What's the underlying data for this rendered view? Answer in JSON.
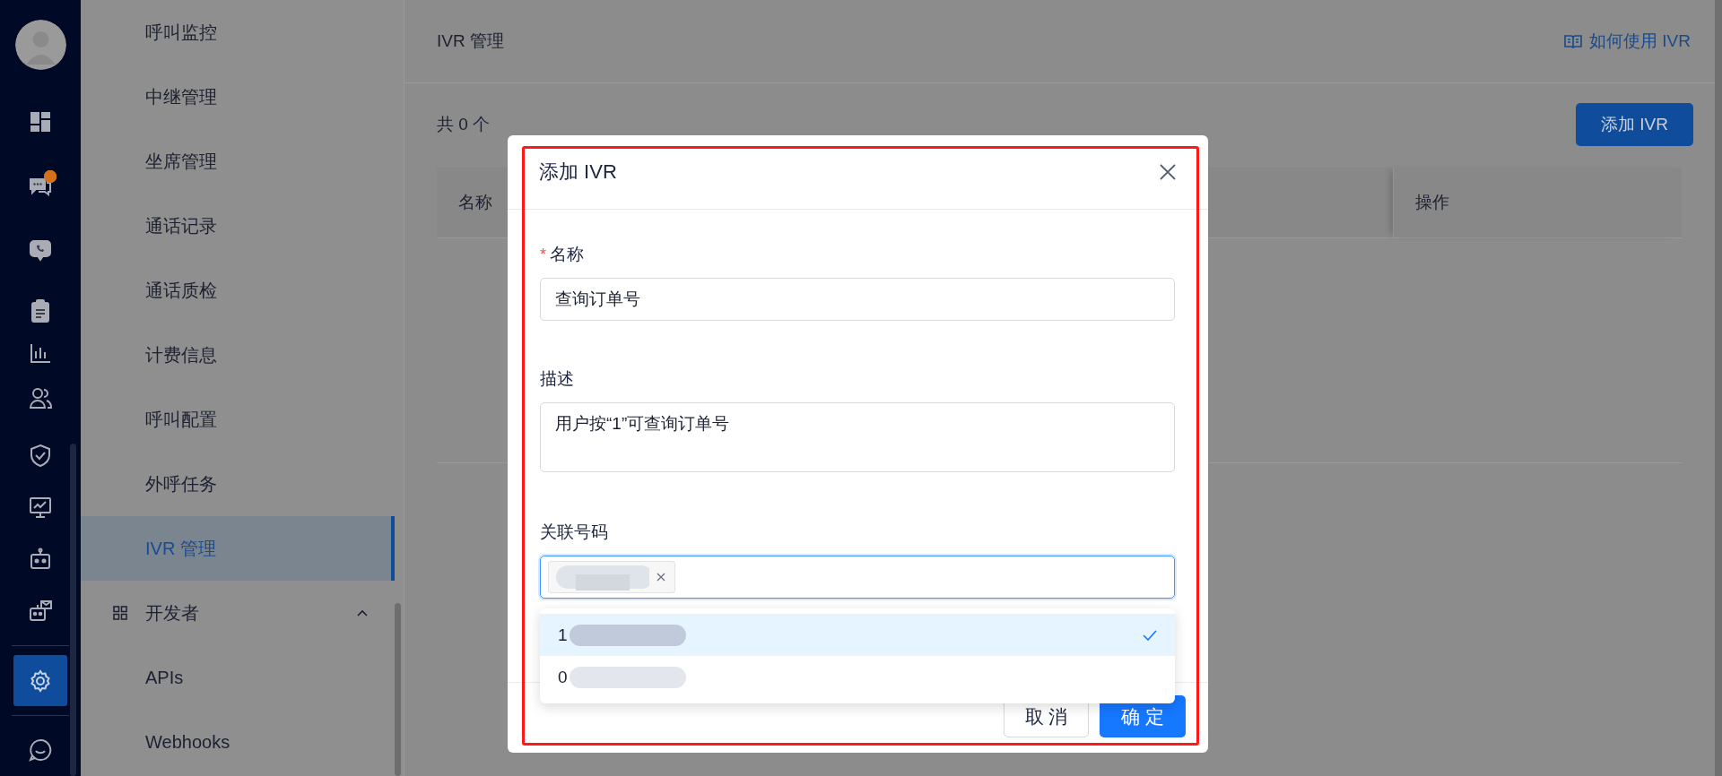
{
  "rail": {
    "items": [
      {
        "selected": false,
        "badge": false
      },
      {
        "selected": false,
        "badge": true
      },
      {
        "selected": false,
        "badge": false
      },
      {
        "selected": false,
        "badge": false
      },
      {
        "selected": false,
        "badge": false
      },
      {
        "selected": false,
        "badge": false
      },
      {
        "selected": false,
        "badge": false
      },
      {
        "selected": false,
        "badge": false
      },
      {
        "selected": false,
        "badge": false
      },
      {
        "selected": false,
        "badge": false
      },
      {
        "selected": true,
        "badge": false
      },
      {
        "selected": false,
        "badge": false
      }
    ]
  },
  "submenu": {
    "items": [
      {
        "kind": "item",
        "label": "呼叫监控",
        "selected": false
      },
      {
        "kind": "item",
        "label": "中继管理",
        "selected": false
      },
      {
        "kind": "item",
        "label": "坐席管理",
        "selected": false
      },
      {
        "kind": "item",
        "label": "通话记录",
        "selected": false
      },
      {
        "kind": "item",
        "label": "通话质检",
        "selected": false
      },
      {
        "kind": "item",
        "label": "计费信息",
        "selected": false
      },
      {
        "kind": "item",
        "label": "呼叫配置",
        "selected": false
      },
      {
        "kind": "item",
        "label": "外呼任务",
        "selected": false
      },
      {
        "kind": "item",
        "label": "IVR 管理",
        "selected": true
      },
      {
        "kind": "group",
        "label": "开发者",
        "expanded": true,
        "children": [
          {
            "label": "APIs",
            "selected": false
          },
          {
            "label": "Webhooks",
            "selected": false
          }
        ]
      }
    ]
  },
  "main": {
    "title": "IVR 管理",
    "help_link": "如何使用 IVR",
    "count": "共 0 个",
    "add_button": "添加 IVR",
    "table": {
      "columns": [
        "名称",
        "操作"
      ]
    }
  },
  "modal": {
    "title": "添加 IVR",
    "fields": [
      {
        "kind": "input",
        "required_mark": "*",
        "label": "名称",
        "value": "查询订单号"
      },
      {
        "kind": "textarea",
        "label": "描述",
        "value": "用户按“1”可查询订单号"
      },
      {
        "kind": "tags",
        "label": "关联号码",
        "focused": true,
        "tags": [
          {
            "kind": "redacted"
          }
        ],
        "options": [
          {
            "text": "1",
            "selected": true
          },
          {
            "text": "0",
            "selected": false
          }
        ]
      }
    ],
    "buttons": [
      {
        "kind": "cancel",
        "label": "取 消"
      },
      {
        "kind": "ok",
        "label": "确 定"
      }
    ]
  }
}
